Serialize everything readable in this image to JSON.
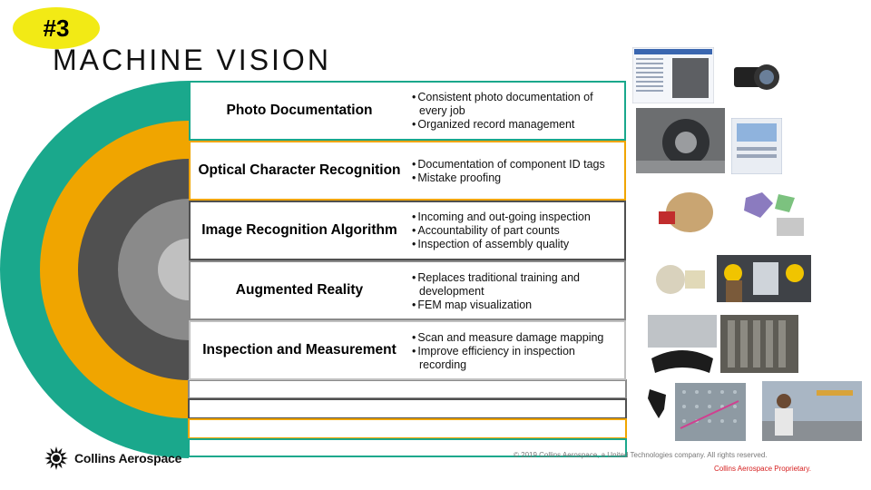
{
  "badge": "#3",
  "title": "MACHINE VISION",
  "rows": [
    {
      "label": "Photo Documentation",
      "bullets": [
        "Consistent photo documentation of every job",
        "Organized record management"
      ]
    },
    {
      "label": "Optical Character Recognition",
      "bullets": [
        "Documentation of component ID tags",
        "Mistake proofing"
      ]
    },
    {
      "label": "Image Recognition Algorithm",
      "bullets": [
        "Incoming and out-going inspection",
        "Accountability of part counts",
        "Inspection of assembly quality"
      ]
    },
    {
      "label": "Augmented Reality",
      "bullets": [
        "Replaces traditional training and development",
        "FEM map visualization"
      ]
    },
    {
      "label": "Inspection and Measurement",
      "bullets": [
        "Scan and measure damage mapping",
        "Improve  efficiency in inspection recording"
      ]
    }
  ],
  "footer": {
    "logo_text": "Collins Aerospace",
    "copyright": "© 2019 Collins Aerospace, a United Technologies company. All rights reserved.",
    "proprietary": "Collins Aerospace  Proprietary."
  },
  "colors": {
    "teal": "#1aa88c",
    "gold": "#f0a500",
    "dark_gray": "#505050",
    "mid_gray": "#8a8a8a",
    "light_gray": "#c0c0c0",
    "badge_yellow": "#f2ea15"
  }
}
